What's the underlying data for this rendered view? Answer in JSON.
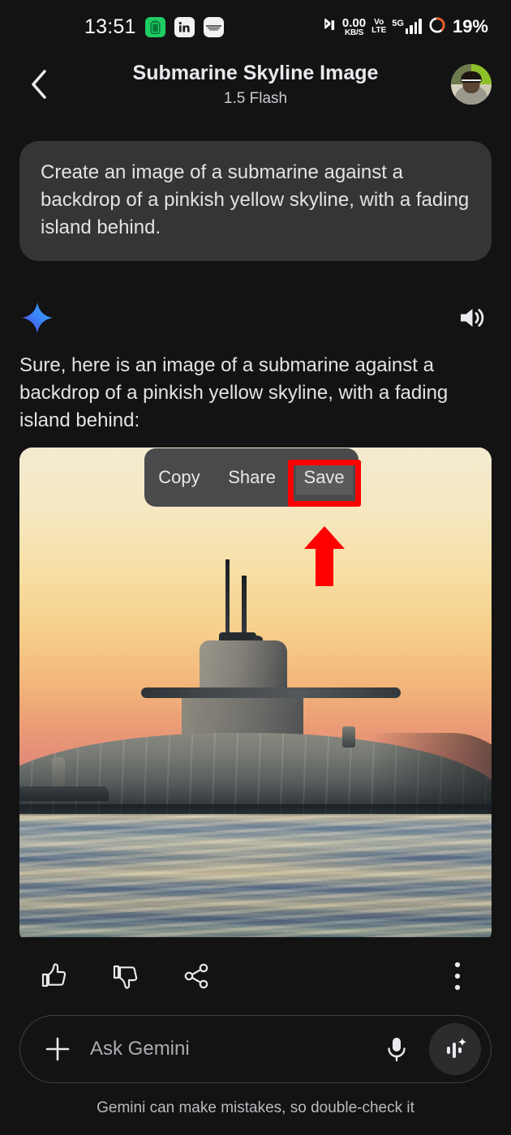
{
  "status_bar": {
    "clock": "13:51",
    "app_icons": [
      "battery-app-icon",
      "linkedin-icon",
      "wallet-icon"
    ],
    "net_speed_value": "0.00",
    "net_speed_unit": "KB/S",
    "volte_line1": "Vo",
    "volte_line2": "LTE",
    "network": "5G",
    "battery_percent": "19%",
    "bluetooth": "bluetooth-icon"
  },
  "header": {
    "back_icon": "chevron-left-icon",
    "title": "Submarine Skyline Image",
    "subtitle": "1.5 Flash",
    "avatar": "user-avatar"
  },
  "conversation": {
    "user_prompt": "Create an image of a submarine against a backdrop of a pinkish yellow skyline, with a fading island behind.",
    "model_icon": "gemini-sparkle-icon",
    "speaker_icon": "speaker-icon",
    "model_response": "Sure, here is an image of a submarine against a backdrop of a pinkish yellow skyline, with a fading island behind:",
    "generated_image_alt": "submarine-at-sunset-image"
  },
  "context_menu": {
    "items": [
      {
        "label": "Copy",
        "name": "copy"
      },
      {
        "label": "Share",
        "name": "share"
      },
      {
        "label": "Save",
        "name": "save"
      }
    ],
    "highlighted_item": "Save",
    "highlight_color": "#ff0000"
  },
  "feedback_bar": {
    "thumbs_up": "thumb-up-icon",
    "thumbs_down": "thumb-down-icon",
    "share": "share-icon",
    "more": "more-vertical-icon"
  },
  "input_bar": {
    "plus_icon": "plus-icon",
    "placeholder": "Ask Gemini",
    "value": "",
    "mic_icon": "microphone-icon",
    "live_icon": "gemini-live-icon"
  },
  "footer": {
    "disclaimer": "Gemini can make mistakes, so double-check it"
  }
}
